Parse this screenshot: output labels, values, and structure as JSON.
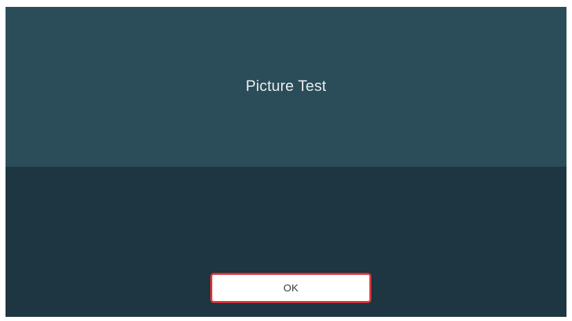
{
  "dialog": {
    "title": "Picture Test",
    "message": "",
    "ok_label": "OK"
  },
  "colors": {
    "header_bg": "#2b4c59",
    "body_bg": "#1e3641",
    "focus_border": "#d6353c"
  }
}
